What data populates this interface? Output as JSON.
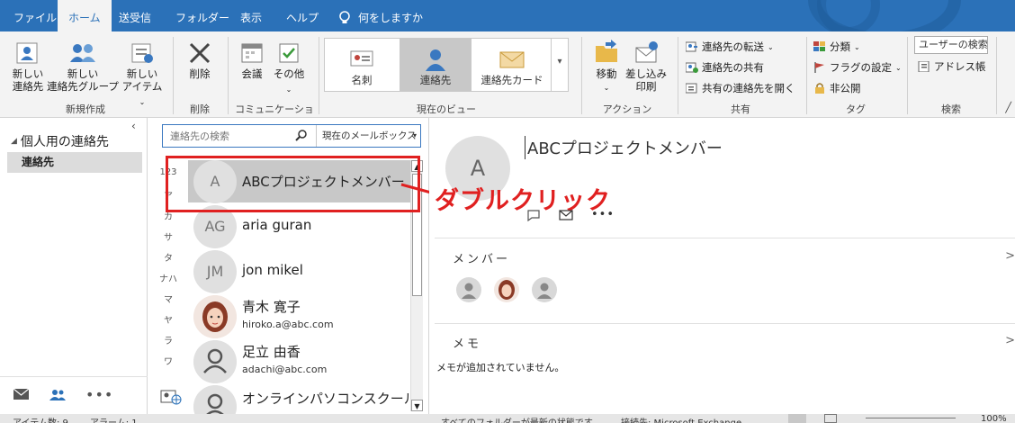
{
  "menu": {
    "tabs": [
      "ファイル",
      "ホーム",
      "送受信",
      "フォルダー",
      "表示",
      "ヘルプ"
    ],
    "tell_me": "何をしますか"
  },
  "ribbon": {
    "new_contact": [
      "新しい",
      "連絡先"
    ],
    "new_group": [
      "新しい",
      "連絡先グループ"
    ],
    "new_items": [
      "新しい",
      "アイテム"
    ],
    "new_group_label": "新規作成",
    "delete": "削除",
    "delete_group": "削除",
    "meeting": "会議",
    "other": "その他",
    "comm_group": "コミュニケーション",
    "views": [
      "名刺",
      "連絡先",
      "連絡先カード"
    ],
    "view_group": "現在のビュー",
    "move": "移動",
    "mail_merge": [
      "差し込み",
      "印刷"
    ],
    "action_group": "アクション",
    "forward_contact": "連絡先の転送",
    "share_contacts": "連絡先の共有",
    "open_shared": "共有の連絡先を開く",
    "share_group": "共有",
    "categorize": "分類",
    "follow_up": "フラグの設定",
    "private": "非公開",
    "tags_group": "タグ",
    "search_people": "ユーザーの検索",
    "address_book": "アドレス帳",
    "search_group": "検索"
  },
  "nav": {
    "folder_header": "個人用の連絡先",
    "folder_item": "連絡先"
  },
  "list": {
    "search_placeholder": "連絡先の検索",
    "scope": "現在のメールボックス",
    "alpha": [
      "123",
      "ア",
      "カ",
      "サ",
      "タ",
      "ナハ",
      "マ",
      "ヤ",
      "ラ",
      "ワ"
    ],
    "contacts": [
      {
        "initials": "A",
        "name": "ABCプロジェクトメンバー",
        "email": ""
      },
      {
        "initials": "AG",
        "name": "aria guran",
        "email": ""
      },
      {
        "initials": "JM",
        "name": "jon mikel",
        "email": ""
      },
      {
        "initials": "",
        "name": "青木 寛子",
        "email": "hiroko.a@abc.com"
      },
      {
        "initials": "",
        "name": "足立 由香",
        "email": "adachi@abc.com"
      },
      {
        "initials": "",
        "name": "オンラインパソコンスクール…",
        "email": ""
      }
    ],
    "annotation": "ダブルクリック"
  },
  "reading": {
    "initial": "A",
    "title": "ABCプロジェクトメンバー",
    "members_header": "メンバー",
    "memo_header": "メモ",
    "memo_text": "メモが追加されていません。"
  },
  "status": {
    "items": "アイテム数: 9",
    "alarms": "アラーム: 1",
    "sync": "すべてのフォルダーが最新の状態です。",
    "connected": "接続先: Microsoft Exchange",
    "zoom": "100%"
  },
  "colors": {
    "brand": "#2b71b8",
    "annotation": "#e02020"
  }
}
